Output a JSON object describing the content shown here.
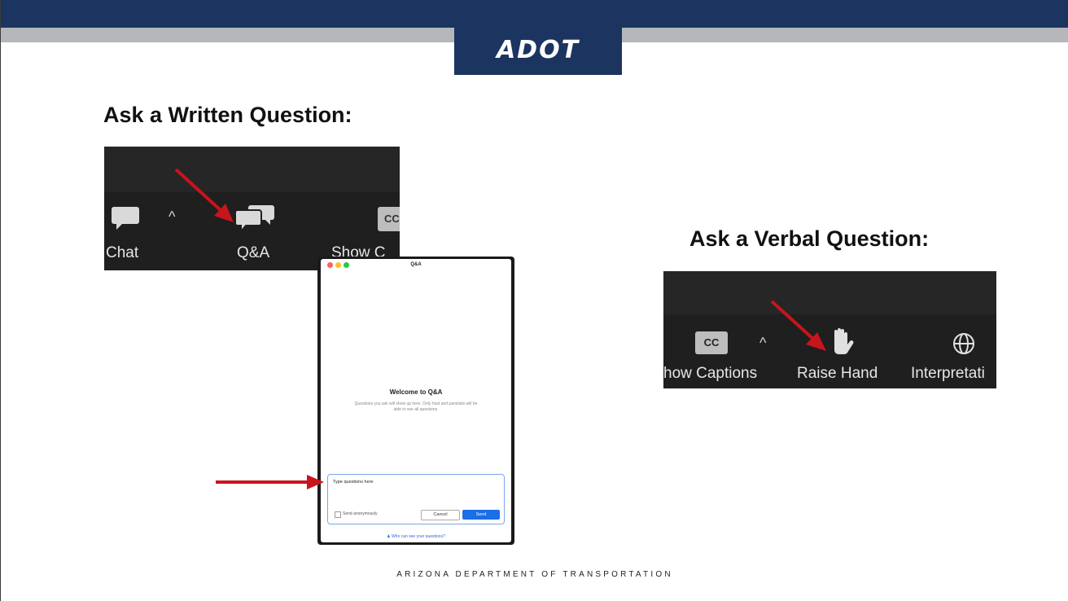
{
  "header": {
    "logo": "ADOT"
  },
  "written_section": {
    "heading": "Ask a Written Question:",
    "toolbar": {
      "chat_label": "Chat",
      "qa_label": "Q&A",
      "captions_label": "Show C",
      "captions_icon_text": "CC"
    }
  },
  "qa_window": {
    "title": "Q&A",
    "welcome_title": "Welcome to Q&A",
    "welcome_body": "Questions you ask will show up here. Only host and panelists will be able to see all questions.",
    "input_text": "Type questions here",
    "anonymous_label": "Send anonymously",
    "cancel_label": "Cancel",
    "send_label": "Send",
    "who_link": "Who can see your questions?"
  },
  "verbal_section": {
    "heading": "Ask a Verbal Question:",
    "toolbar": {
      "captions_icon_text": "CC",
      "captions_label": "how Captions",
      "raise_hand_label": "Raise Hand",
      "interpretation_label": "Interpretati"
    }
  },
  "footer": {
    "text": "ARIZONA DEPARTMENT OF TRANSPORTATION"
  },
  "colors": {
    "brand_navy": "#1b3560",
    "band_gray": "#b5b7ba",
    "arrow_red": "#c8141c",
    "send_blue": "#1a6ee8"
  }
}
